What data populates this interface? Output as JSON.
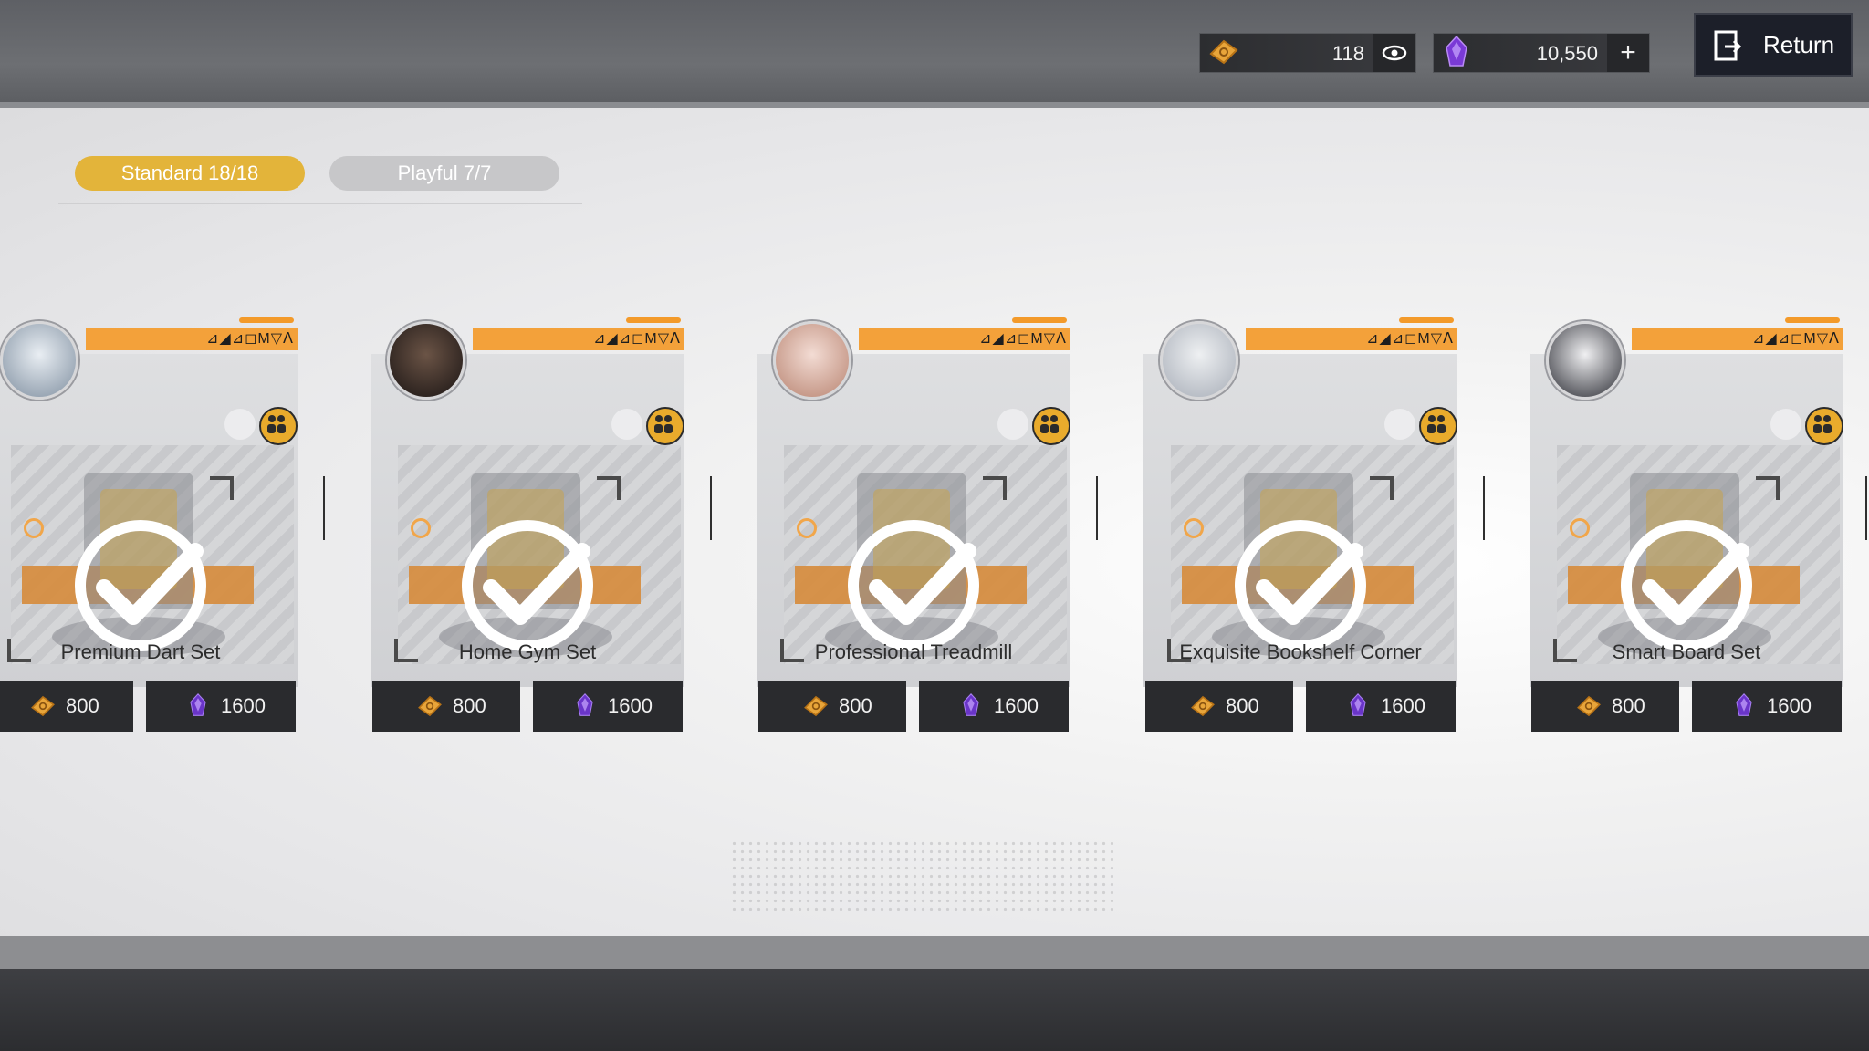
{
  "topbar": {
    "tickets": "118",
    "crystals": "10,550",
    "return_label": "Return"
  },
  "tabs": [
    {
      "label": "Standard 18/18",
      "active": true
    },
    {
      "label": "Playful 7/7",
      "active": false
    }
  ],
  "cards": [
    {
      "name": "Premium Dart Set",
      "price_ticket": "800",
      "price_crystal": "1600"
    },
    {
      "name": "Home Gym Set",
      "price_ticket": "800",
      "price_crystal": "1600"
    },
    {
      "name": "Professional Treadmill",
      "price_ticket": "800",
      "price_crystal": "1600"
    },
    {
      "name": "Exquisite Bookshelf Corner",
      "price_ticket": "800",
      "price_crystal": "1600"
    },
    {
      "name": "Smart Board Set",
      "price_ticket": "800",
      "price_crystal": "1600"
    }
  ],
  "card_runes": "⊿◢⊿◻M▽ᐱ",
  "colors": {
    "accent": "#e3b43a",
    "orange": "#f3a13a",
    "dark": "#2a2b2e"
  },
  "icons": [
    "ticket-icon",
    "eye-icon",
    "crystal-icon",
    "plus-icon",
    "return-icon",
    "checkmark-icon",
    "people-icon"
  ]
}
